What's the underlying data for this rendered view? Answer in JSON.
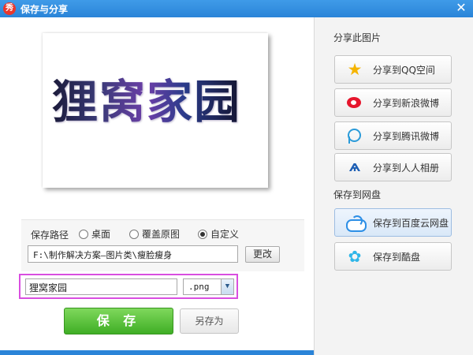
{
  "window": {
    "title": "保存与分享",
    "app_icon_glyph": "秀",
    "close_glyph": "✕"
  },
  "preview": {
    "text": "狸窝家园"
  },
  "save_path": {
    "label": "保存路径",
    "options": [
      {
        "label": "桌面",
        "selected": false
      },
      {
        "label": "覆盖原图",
        "selected": false
      },
      {
        "label": "自定义",
        "selected": true
      }
    ],
    "path_value": "F:\\制作解决方案—图片类\\瘦脸瘦身",
    "change_button": "更改"
  },
  "file": {
    "name_value": "狸窝家园",
    "extension": ".png",
    "dropdown_glyph": "▼"
  },
  "actions": {
    "save": "保 存",
    "save_as": "另存为"
  },
  "share": {
    "section_title": "分享此图片",
    "buttons": [
      {
        "label": "分享到QQ空间",
        "icon": "star-icon"
      },
      {
        "label": "分享到新浪微博",
        "icon": "weibo-icon"
      },
      {
        "label": "分享到腾讯微博",
        "icon": "tencent-weibo-icon"
      },
      {
        "label": "分享到人人相册",
        "icon": "renren-icon"
      }
    ]
  },
  "cloud": {
    "section_title": "保存到网盘",
    "buttons": [
      {
        "label": "保存到百度云网盘",
        "icon": "cloud-icon",
        "active": true
      },
      {
        "label": "保存到酷盘",
        "icon": "kupan-icon",
        "active": false
      }
    ]
  },
  "colors": {
    "titlebar": "#2a84d8",
    "save_button": "#3fae25",
    "highlight_border": "#d94ee0"
  }
}
